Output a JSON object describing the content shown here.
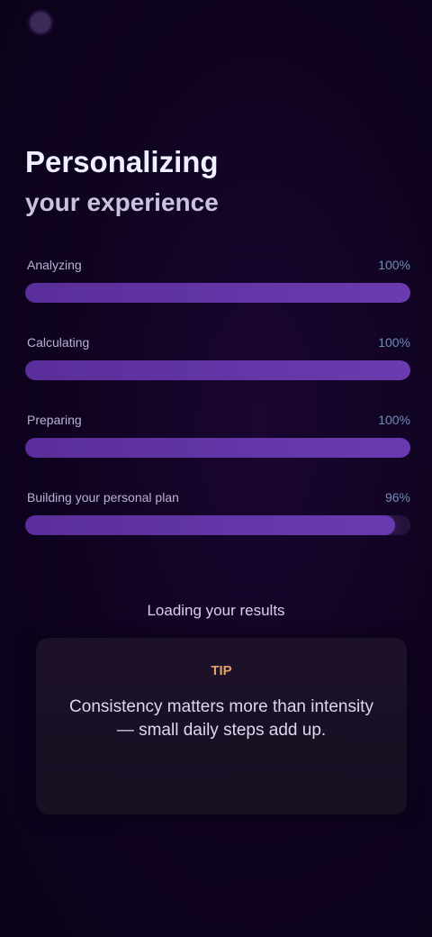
{
  "header": {
    "brand": ""
  },
  "headline": {
    "title": "Personalizing",
    "subtitle": "your experience"
  },
  "bars": [
    {
      "label": "Analyzing",
      "value": "100%",
      "fill": 1.0
    },
    {
      "label": "Calculating",
      "value": "100%",
      "fill": 1.0
    },
    {
      "label": "Preparing",
      "value": "100%",
      "fill": 1.0
    },
    {
      "label": "Building your personal plan",
      "value": "96%",
      "fill": 0.96
    }
  ],
  "info": {
    "text": "Loading your results"
  },
  "card": {
    "tag": "TIP",
    "body": "Consistency matters more than intensity — small daily steps add up.",
    "footer": ""
  },
  "colors": {
    "accent": "#6a3bb0",
    "tag": "#e0a36c",
    "background": "#0f0320"
  }
}
